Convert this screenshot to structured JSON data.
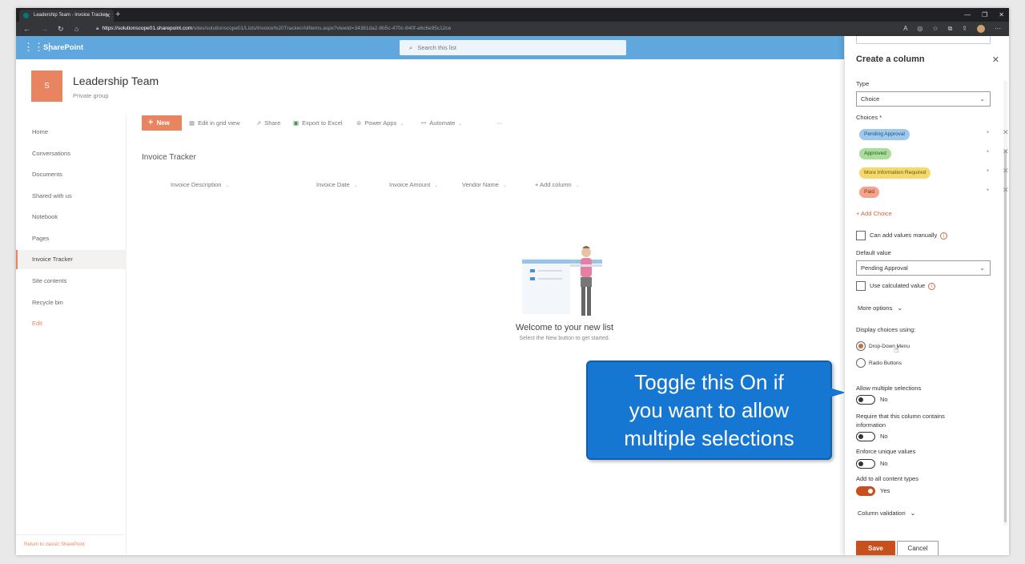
{
  "browser": {
    "tab_title": "Leadership Team - Invoice Tracker",
    "url_host": "https://solutionscope01.sharepoint.com",
    "url_path": "/sites/solutionscope01/Lists/Invoice%20Tracker/AllItems.aspx?viewid=34381da2-8b5c-470c-840f-a6c6e95c12ce"
  },
  "suitebar": {
    "brand": "SharePoint",
    "search_placeholder": "Search this list",
    "color": "#5fa7dc"
  },
  "site": {
    "logo_letter": "S",
    "title": "Leadership Team",
    "subtitle": "Private group"
  },
  "nav": {
    "items": [
      "Home",
      "Conversations",
      "Documents",
      "Shared with us",
      "Notebook",
      "Pages",
      "Invoice Tracker",
      "Site contents",
      "Recycle bin",
      "Edit"
    ],
    "selected": "Invoice Tracker",
    "return_link": "Return to classic SharePoint"
  },
  "commandbar": {
    "new_label": "New",
    "edit_grid": "Edit in grid view",
    "share": "Share",
    "export": "Export to Excel",
    "power_apps": "Power Apps",
    "automate": "Automate",
    "more": "···"
  },
  "list": {
    "title": "Invoice Tracker",
    "columns": [
      "Invoice Description",
      "Invoice Date",
      "Invoice Amount",
      "Vendor Name",
      "+ Add column"
    ]
  },
  "empty_state": {
    "title": "Welcome to your new list",
    "subtitle": "Select the New button to get started."
  },
  "callout": {
    "line1": "Toggle this On if",
    "line2": "you want to allow",
    "line3": "multiple selections",
    "color": "#1677d2"
  },
  "panel": {
    "title": "Create a column",
    "type_label": "Type",
    "type_value": "Choice",
    "choices_label": "Choices *",
    "choices": [
      {
        "label": "Pending Approval",
        "bg": "#9fc8ee",
        "fg": "#1d4f7a"
      },
      {
        "label": "Approved",
        "bg": "#a8dd9a",
        "fg": "#2d5a22"
      },
      {
        "label": "More Information Required",
        "bg": "#f6d96b",
        "fg": "#6a5510"
      },
      {
        "label": "Paid",
        "bg": "#f4a48a",
        "fg": "#7a2f17"
      }
    ],
    "add_choice": "+ Add Choice",
    "can_add_manually": "Can add values manually",
    "default_value_label": "Default value",
    "default_value": "Pending Approval",
    "use_calculated": "Use calculated value",
    "more_options": "More options",
    "display_choices_label": "Display choices using:",
    "display_options": [
      "Drop-Down Menu",
      "Radio Buttons"
    ],
    "display_selected": "Drop-Down Menu",
    "allow_multiple_label": "Allow multiple selections",
    "allow_multiple_value": "No",
    "require_label": "Require that this column contains information",
    "require_value": "No",
    "unique_label": "Enforce unique values",
    "unique_value": "No",
    "content_types_label": "Add to all content types",
    "content_types_value": "Yes",
    "column_validation": "Column validation",
    "save": "Save",
    "cancel": "Cancel"
  }
}
